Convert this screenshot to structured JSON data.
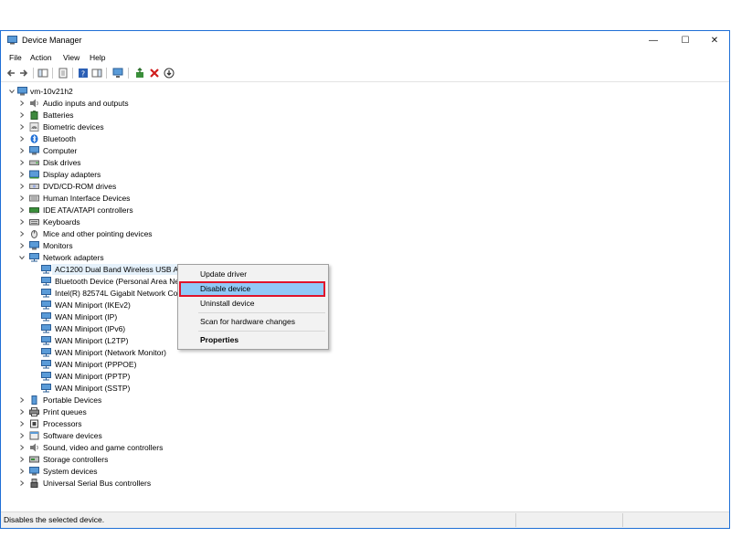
{
  "window": {
    "title": "Device Manager",
    "controls": {
      "minimize": "—",
      "maximize": "☐",
      "close": "✕"
    }
  },
  "menu": {
    "items": [
      "File",
      "Action",
      "View",
      "Help"
    ]
  },
  "tree": {
    "root": "vm-10v21h2",
    "categories": [
      "Audio inputs and outputs",
      "Batteries",
      "Biometric devices",
      "Bluetooth",
      "Computer",
      "Disk drives",
      "Display adapters",
      "DVD/CD-ROM drives",
      "Human Interface Devices",
      "IDE ATA/ATAPI controllers",
      "Keyboards",
      "Mice and other pointing devices",
      "Monitors",
      "Network adapters"
    ],
    "network_adapters": [
      "AC1200  Dual Band Wireless USB Adapter",
      "Bluetooth Device (Personal Area Net",
      "Intel(R) 82574L Gigabit Network Con",
      "WAN Miniport (IKEv2)",
      "WAN Miniport (IP)",
      "WAN Miniport (IPv6)",
      "WAN Miniport (L2TP)",
      "WAN Miniport (Network Monitor)",
      "WAN Miniport (PPPOE)",
      "WAN Miniport (PPTP)",
      "WAN Miniport (SSTP)"
    ],
    "categories_after": [
      "Portable Devices",
      "Print queues",
      "Processors",
      "Software devices",
      "Sound, video and game controllers",
      "Storage controllers",
      "System devices",
      "Universal Serial Bus controllers"
    ]
  },
  "context_menu": {
    "update_driver": "Update driver",
    "disable_device": "Disable device",
    "uninstall_device": "Uninstall device",
    "scan_hardware": "Scan for hardware changes",
    "properties": "Properties"
  },
  "status": {
    "text": "Disables the selected device."
  },
  "colors": {
    "accent": "#1f6fd6",
    "highlight": "#91c9f7",
    "callout": "#e0142b"
  }
}
